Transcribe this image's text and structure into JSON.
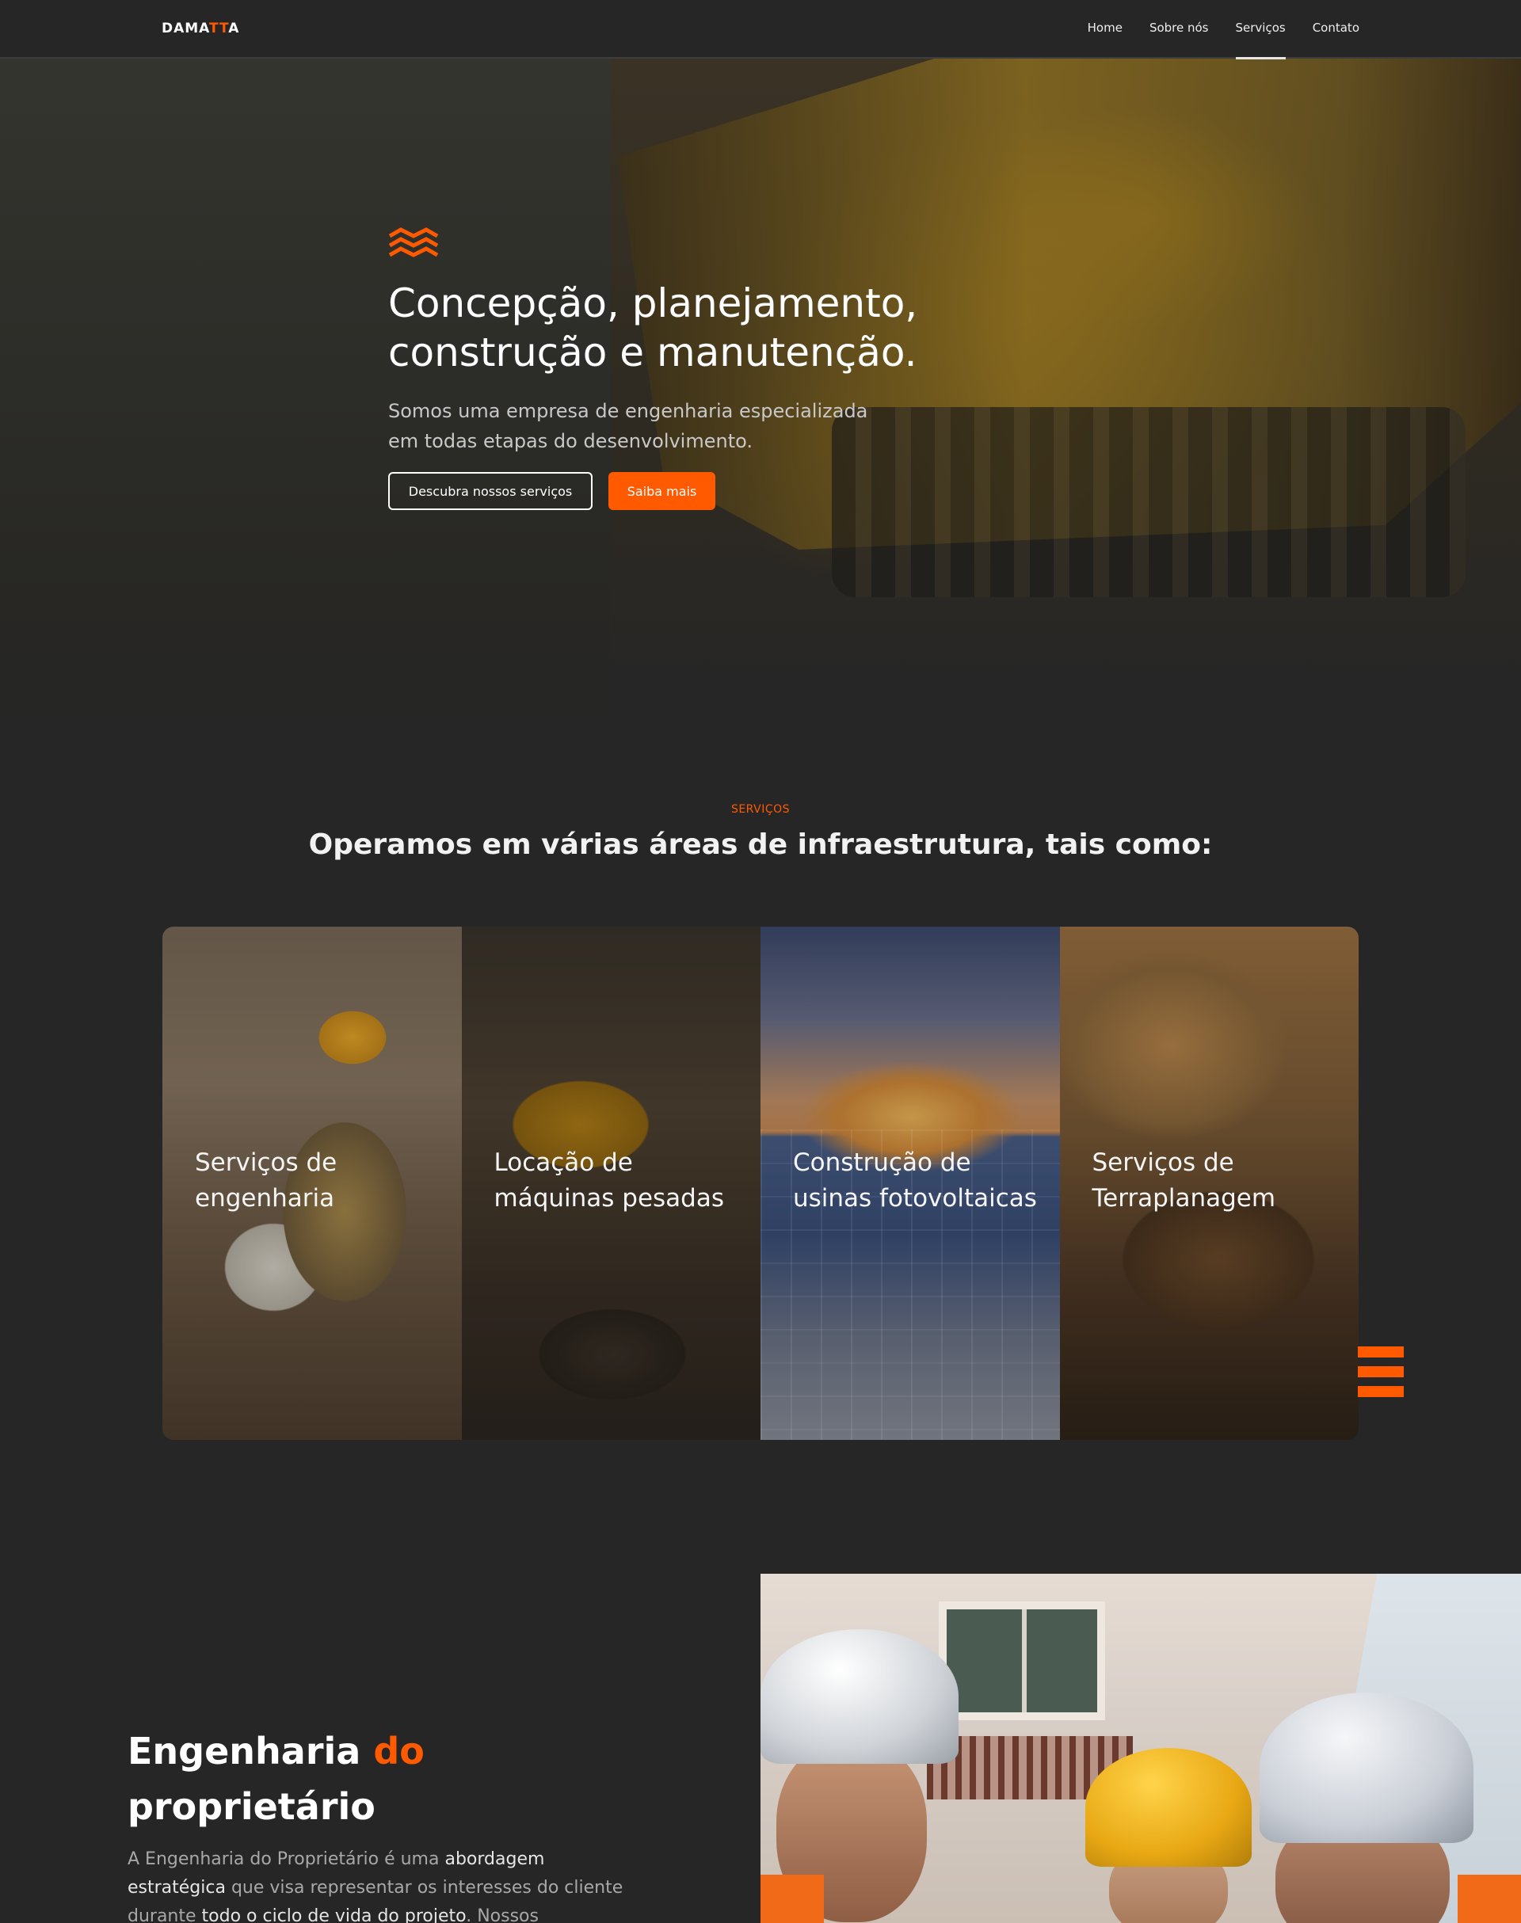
{
  "brand": {
    "logo_main": "DAMA",
    "logo_accent": "TT",
    "logo_end": "A",
    "accent_color": "#ff5a00",
    "background_color": "#262626"
  },
  "nav": {
    "items": [
      {
        "label": "Home"
      },
      {
        "label": "Sobre nós"
      },
      {
        "label": "Serviços",
        "active": true
      },
      {
        "label": "Contato"
      }
    ]
  },
  "hero": {
    "icon": "waves-icon",
    "title_line1": "Concepção, planejamento,",
    "title_line2": "construção e manutenção.",
    "subtitle_line1": "Somos uma empresa de engenharia especializada",
    "subtitle_line2": "em todas etapas do desenvolvimento.",
    "buttons": {
      "secondary": "Descubra nossos serviços",
      "primary": "Saiba mais"
    }
  },
  "services": {
    "kicker": "SERVIÇOS",
    "title": "Operamos em várias áreas de infraestrutura, tais como:",
    "cards": [
      {
        "line1": "Serviços de",
        "line2": "engenharia"
      },
      {
        "line1": "Locação de",
        "line2": "máquinas pesadas"
      },
      {
        "line1": "Construção de",
        "line2": "usinas fotovoltaicas"
      },
      {
        "line1": "Serviços de",
        "line2": "Terraplanagem"
      }
    ],
    "menu_icon": "hamburger-menu-icon"
  },
  "owner": {
    "title_part1": "Engenharia ",
    "title_accent": "do",
    "title_part2": "proprietário",
    "text": {
      "t1": "A Engenharia do Proprietário é uma ",
      "b1": "abordagem estratégica",
      "t2": " que visa representar os interesses do cliente durante ",
      "b2": "todo o ciclo de vida do projeto",
      "t3": ". Nossos"
    }
  }
}
